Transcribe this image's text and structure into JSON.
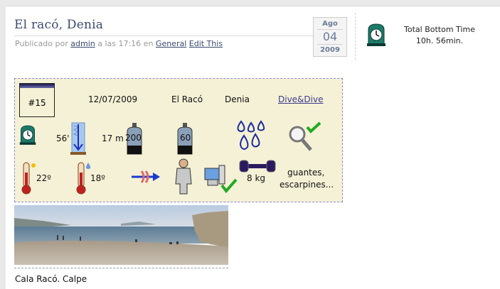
{
  "post": {
    "title": "El racó, Denia",
    "meta_prefix": "Publicado por",
    "author": "admin",
    "meta_time": "a las 17:16 en",
    "category": "General",
    "edit_link": "Edit This",
    "date": {
      "month": "Ago",
      "day": "04",
      "year": "2009"
    }
  },
  "sidebar": {
    "icon": "clock-icon",
    "label": "Total Bottom Time",
    "value": "10h. 56min."
  },
  "dive": {
    "number": "#15",
    "date": "12/07/2009",
    "site": "El Racó",
    "location": "Denia",
    "club": "Dive&Dive",
    "duration": "56'",
    "depth": "17 m",
    "pressure_start": "200",
    "pressure_end": "60",
    "air_temp": "22º",
    "water_temp": "18º",
    "weights": "8 kg",
    "gear_line1": "guantes,",
    "gear_line2": "escarpines..."
  },
  "photo": {
    "caption": "Cala Racó. Calpe"
  },
  "colors": {
    "title": "#3b4a6b",
    "card_bg": "#f5f1d6",
    "card_border": "#8a8ad0",
    "check": "#22aa22"
  }
}
